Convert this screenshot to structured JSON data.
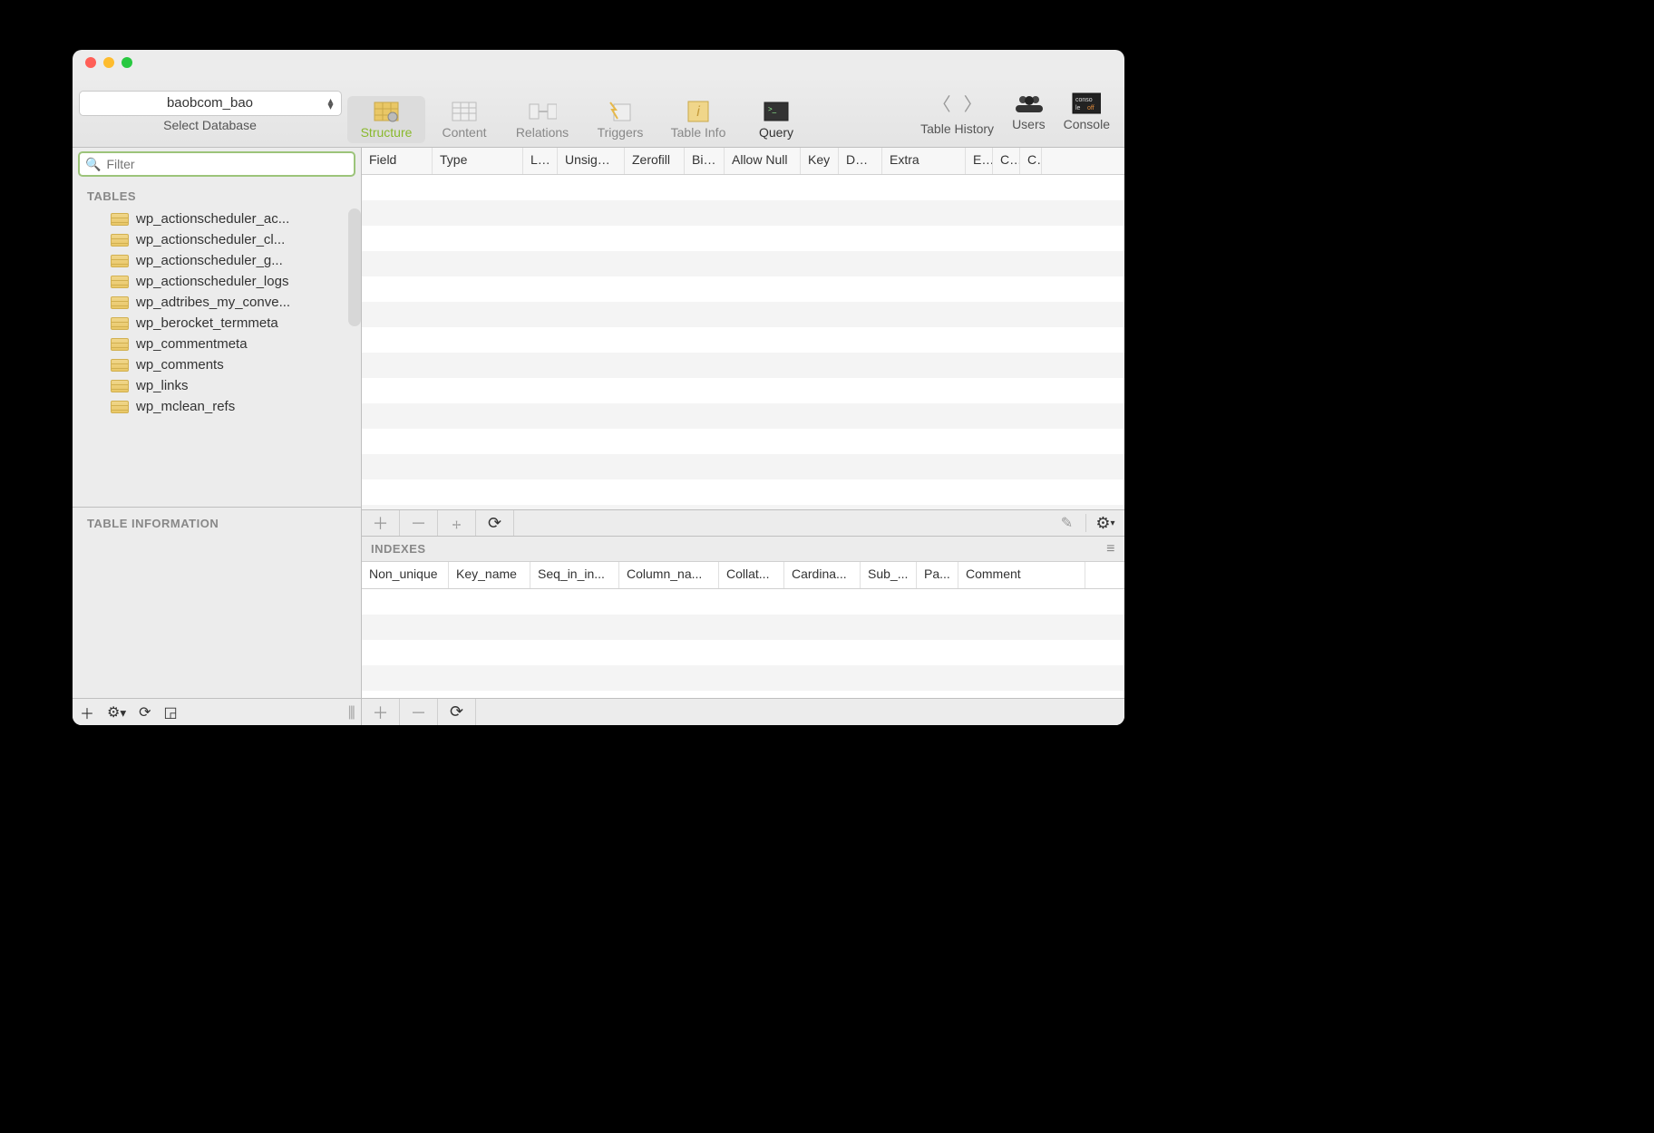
{
  "database": {
    "name": "baobcom_bao",
    "select_label": "Select Database"
  },
  "toolbar": {
    "structure": "Structure",
    "content": "Content",
    "relations": "Relations",
    "triggers": "Triggers",
    "table_info": "Table Info",
    "query": "Query",
    "table_history": "Table History",
    "users": "Users",
    "console": "Console"
  },
  "sidebar": {
    "filter_placeholder": "Filter",
    "tables_header": "TABLES",
    "tables": [
      "wp_actionscheduler_ac...",
      "wp_actionscheduler_cl...",
      "wp_actionscheduler_g...",
      "wp_actionscheduler_logs",
      "wp_adtribes_my_conve...",
      "wp_berocket_termmeta",
      "wp_commentmeta",
      "wp_comments",
      "wp_links",
      "wp_mclean_refs"
    ],
    "table_info_header": "TABLE INFORMATION"
  },
  "fields": {
    "columns": [
      "Field",
      "Type",
      "Le...",
      "Unsigned",
      "Zerofill",
      "Bin...",
      "Allow Null",
      "Key",
      "Def...",
      "Extra",
      "E...",
      "C...",
      "C."
    ]
  },
  "indexes": {
    "header": "INDEXES",
    "columns": [
      "Non_unique",
      "Key_name",
      "Seq_in_in...",
      "Column_na...",
      "Collat...",
      "Cardina...",
      "Sub_...",
      "Pa...",
      "Comment"
    ]
  }
}
